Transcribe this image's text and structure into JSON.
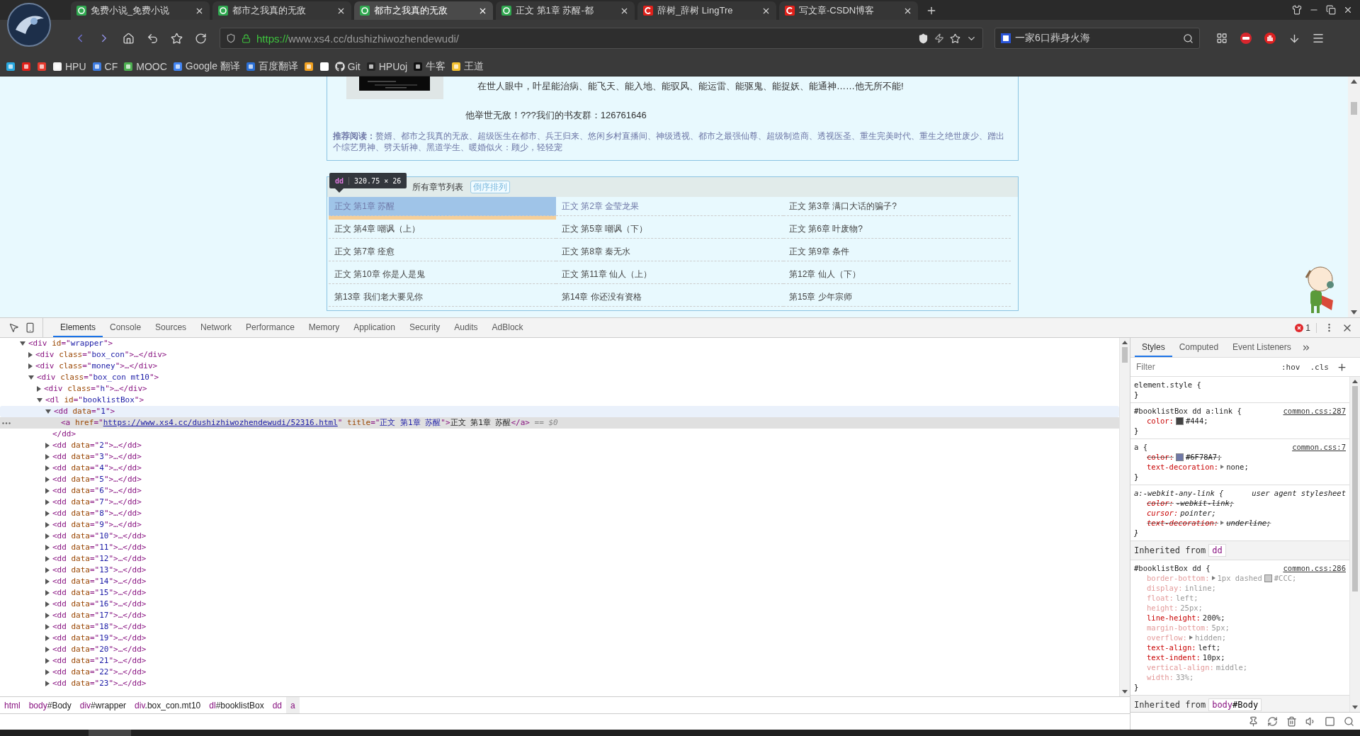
{
  "browser": {
    "tabs": [
      {
        "title": "免费小说_免费小说",
        "kind": "book",
        "selected": false
      },
      {
        "title": "都市之我真的无敌",
        "kind": "book",
        "selected": false
      },
      {
        "title": "都市之我真的无敌",
        "kind": "book",
        "selected": true
      },
      {
        "title": "正文 第1章 苏醒-都",
        "kind": "book",
        "selected": false
      },
      {
        "title": "辞树_辞树 LingTre",
        "kind": "csdn",
        "selected": false
      },
      {
        "title": "写文章-CSDN博客",
        "kind": "csdn",
        "selected": false
      }
    ],
    "address": {
      "scheme": "https://",
      "rest": "www.xs4.cc/dushizhiwozhendewudi/"
    },
    "search": {
      "value": "一家6口葬身火海"
    },
    "bookmarks": [
      {
        "kind": "icon"
      },
      {
        "kind": "icon"
      },
      {
        "kind": "icon"
      },
      {
        "kind": "link",
        "label": "HPU"
      },
      {
        "kind": "link",
        "label": "CF"
      },
      {
        "kind": "link",
        "label": "MOOC"
      },
      {
        "kind": "link",
        "label": "Google 翻译"
      },
      {
        "kind": "link",
        "label": "百度翻译"
      },
      {
        "kind": "icon"
      },
      {
        "kind": "icon"
      },
      {
        "kind": "link",
        "label": "Git"
      },
      {
        "kind": "link",
        "label": "HPUoj"
      },
      {
        "kind": "link",
        "label": "牛客"
      },
      {
        "kind": "link",
        "label": "王道"
      }
    ]
  },
  "page": {
    "intro": "在世人眼中，叶星能治病、能飞天、能入地、能驭风、能运雷、能驱鬼、能捉妖、能通神……他无所不能!",
    "group_line": "他举世无敌！???我们的书友群：126761646",
    "recommend": "**推荐阅读：**赘婿、都市之我真的无敌、超级医生在都市、兵王归来、悠闲乡村直播间、神级透视、都市之最强仙尊、超级制造商、透视医圣、重生完美时代、重生之绝世废少、蹭出个综艺男神、劈天斩神、黑道学生、暖婚似火：顾少，轻轻宠",
    "chapter_list": {
      "heading": "所有章节列表",
      "sort_button": "倒序排列",
      "chapters": [
        {
          "title": "正文 第1章 苏醒",
          "selected": true,
          "visited": true
        },
        {
          "title": "正文 第2章 金莹龙果",
          "selected": false,
          "visited": true
        },
        {
          "title": "正文 第3章 满口大话的骗子?",
          "selected": false,
          "visited": false
        },
        {
          "title": "正文 第4章 嘲讽（上）",
          "selected": false,
          "visited": false
        },
        {
          "title": "正文 第5章 嘲讽（下）",
          "selected": false,
          "visited": false
        },
        {
          "title": "正文 第6章 叶废物?",
          "selected": false,
          "visited": false
        },
        {
          "title": "正文 第7章 痊愈",
          "selected": false,
          "visited": false
        },
        {
          "title": "正文 第8章 秦无水",
          "selected": false,
          "visited": false
        },
        {
          "title": "正文 第9章 条件",
          "selected": false,
          "visited": false
        },
        {
          "title": "正文 第10章 你是人是鬼",
          "selected": false,
          "visited": false
        },
        {
          "title": "正文 第11章 仙人（上）",
          "selected": false,
          "visited": false
        },
        {
          "title": "第12章 仙人（下）",
          "selected": false,
          "visited": false
        },
        {
          "title": "第13章 我们老大要见你",
          "selected": false,
          "visited": false
        },
        {
          "title": "第14章 你还没有资格",
          "selected": false,
          "visited": false
        },
        {
          "title": "第15章 少年宗师",
          "selected": false,
          "visited": false
        }
      ]
    },
    "inspect_tooltip": {
      "tag": "dd",
      "size": "320.75 × 26"
    }
  },
  "devtools": {
    "tabs": [
      {
        "label": "Elements",
        "selected": true
      },
      {
        "label": "Console",
        "selected": false
      },
      {
        "label": "Sources",
        "selected": false
      },
      {
        "label": "Network",
        "selected": false
      },
      {
        "label": "Performance",
        "selected": false
      },
      {
        "label": "Memory",
        "selected": false
      },
      {
        "label": "Application",
        "selected": false
      },
      {
        "label": "Security",
        "selected": false
      },
      {
        "label": "Audits",
        "selected": false
      },
      {
        "label": "AdBlock",
        "selected": false
      }
    ],
    "error_count": "1",
    "dom_tree": [
      {
        "segments": [
          {
            "kind": "tag",
            "text": "<div "
          },
          {
            "kind": "attr",
            "text": "id"
          },
          {
            "kind": "tag",
            "text": "=\""
          },
          {
            "kind": "value",
            "text": "wrapper"
          },
          {
            "kind": "tag",
            "text": "\">"
          }
        ],
        "expanded": true,
        "selected": false,
        "hovered": false,
        "children": [
          {
            "segments": [
              {
                "kind": "tag",
                "text": "<div "
              },
              {
                "kind": "attr",
                "text": "class"
              },
              {
                "kind": "tag",
                "text": "=\""
              },
              {
                "kind": "value",
                "text": "box_con"
              },
              {
                "kind": "tag",
                "text": "\">…</div>"
              }
            ],
            "expanded": false,
            "selected": false,
            "hovered": false
          },
          {
            "segments": [
              {
                "kind": "tag",
                "text": "<div "
              },
              {
                "kind": "attr",
                "text": "class"
              },
              {
                "kind": "tag",
                "text": "=\""
              },
              {
                "kind": "value",
                "text": "money"
              },
              {
                "kind": "tag",
                "text": "\">…</div>"
              }
            ],
            "expanded": false,
            "selected": false,
            "hovered": false
          },
          {
            "segments": [
              {
                "kind": "tag",
                "text": "<div "
              },
              {
                "kind": "attr",
                "text": "class"
              },
              {
                "kind": "tag",
                "text": "=\""
              },
              {
                "kind": "value",
                "text": "box_con mt10"
              },
              {
                "kind": "tag",
                "text": "\">"
              }
            ],
            "expanded": true,
            "selected": false,
            "hovered": false,
            "children": [
              {
                "segments": [
                  {
                    "kind": "tag",
                    "text": "<div "
                  },
                  {
                    "kind": "attr",
                    "text": "class"
                  },
                  {
                    "kind": "tag",
                    "text": "=\""
                  },
                  {
                    "kind": "value",
                    "text": "h"
                  },
                  {
                    "kind": "tag",
                    "text": "\">…</div>"
                  }
                ],
                "expanded": false,
                "selected": false,
                "hovered": false
              },
              {
                "segments": [
                  {
                    "kind": "tag",
                    "text": "<dl "
                  },
                  {
                    "kind": "attr",
                    "text": "id"
                  },
                  {
                    "kind": "tag",
                    "text": "=\""
                  },
                  {
                    "kind": "value",
                    "text": "booklistBox"
                  },
                  {
                    "kind": "tag",
                    "text": "\">"
                  }
                ],
                "expanded": true,
                "selected": false,
                "hovered": false,
                "children": [
                  {
                    "segments": [
                      {
                        "kind": "tag",
                        "text": "<dd "
                      },
                      {
                        "kind": "attr",
                        "text": "data"
                      },
                      {
                        "kind": "tag",
                        "text": "=\""
                      },
                      {
                        "kind": "value",
                        "text": "1"
                      },
                      {
                        "kind": "tag",
                        "text": "\">"
                      }
                    ],
                    "expanded": true,
                    "selected": false,
                    "hovered": true,
                    "closing": [
                      {
                        "kind": "tag",
                        "text": "</dd>"
                      }
                    ],
                    "children": [
                      {
                        "segments": [
                          {
                            "kind": "tag",
                            "text": "<a "
                          },
                          {
                            "kind": "attr",
                            "text": "href"
                          },
                          {
                            "kind": "tag",
                            "text": "=\""
                          },
                          {
                            "kind": "link",
                            "text": "https://www.xs4.cc/dushizhiwozhendewudi/52316.html"
                          },
                          {
                            "kind": "tag",
                            "text": "\" "
                          },
                          {
                            "kind": "attr",
                            "text": "title"
                          },
                          {
                            "kind": "tag",
                            "text": "=\""
                          },
                          {
                            "kind": "value",
                            "text": "正文 第1章 苏醒"
                          },
                          {
                            "kind": "tag",
                            "text": "\">"
                          },
                          {
                            "kind": "text",
                            "text": "正文 第1章 苏醒"
                          },
                          {
                            "kind": "tag",
                            "text": "</a>"
                          },
                          {
                            "kind": "dim",
                            "text": " == $0"
                          }
                        ],
                        "selected": true,
                        "hovered": false
                      }
                    ]
                  },
                  {
                    "segments": [
                      {
                        "kind": "tag",
                        "text": "<dd "
                      },
                      {
                        "kind": "attr",
                        "text": "data"
                      },
                      {
                        "kind": "tag",
                        "text": "=\""
                      },
                      {
                        "kind": "value",
                        "text": "2"
                      },
                      {
                        "kind": "tag",
                        "text": "\">…</dd>"
                      }
                    ],
                    "expanded": false,
                    "selected": false,
                    "hovered": false
                  },
                  {
                    "segments": [
                      {
                        "kind": "tag",
                        "text": "<dd "
                      },
                      {
                        "kind": "attr",
                        "text": "data"
                      },
                      {
                        "kind": "tag",
                        "text": "=\""
                      },
                      {
                        "kind": "value",
                        "text": "3"
                      },
                      {
                        "kind": "tag",
                        "text": "\">…</dd>"
                      }
                    ],
                    "expanded": false,
                    "selected": false,
                    "hovered": false
                  },
                  {
                    "segments": [
                      {
                        "kind": "tag",
                        "text": "<dd "
                      },
                      {
                        "kind": "attr",
                        "text": "data"
                      },
                      {
                        "kind": "tag",
                        "text": "=\""
                      },
                      {
                        "kind": "value",
                        "text": "4"
                      },
                      {
                        "kind": "tag",
                        "text": "\">…</dd>"
                      }
                    ],
                    "expanded": false,
                    "selected": false,
                    "hovered": false
                  },
                  {
                    "segments": [
                      {
                        "kind": "tag",
                        "text": "<dd "
                      },
                      {
                        "kind": "attr",
                        "text": "data"
                      },
                      {
                        "kind": "tag",
                        "text": "=\""
                      },
                      {
                        "kind": "value",
                        "text": "5"
                      },
                      {
                        "kind": "tag",
                        "text": "\">…</dd>"
                      }
                    ],
                    "expanded": false,
                    "selected": false,
                    "hovered": false
                  },
                  {
                    "segments": [
                      {
                        "kind": "tag",
                        "text": "<dd "
                      },
                      {
                        "kind": "attr",
                        "text": "data"
                      },
                      {
                        "kind": "tag",
                        "text": "=\""
                      },
                      {
                        "kind": "value",
                        "text": "6"
                      },
                      {
                        "kind": "tag",
                        "text": "\">…</dd>"
                      }
                    ],
                    "expanded": false,
                    "selected": false,
                    "hovered": false
                  },
                  {
                    "segments": [
                      {
                        "kind": "tag",
                        "text": "<dd "
                      },
                      {
                        "kind": "attr",
                        "text": "data"
                      },
                      {
                        "kind": "tag",
                        "text": "=\""
                      },
                      {
                        "kind": "value",
                        "text": "7"
                      },
                      {
                        "kind": "tag",
                        "text": "\">…</dd>"
                      }
                    ],
                    "expanded": false,
                    "selected": false,
                    "hovered": false
                  },
                  {
                    "segments": [
                      {
                        "kind": "tag",
                        "text": "<dd "
                      },
                      {
                        "kind": "attr",
                        "text": "data"
                      },
                      {
                        "kind": "tag",
                        "text": "=\""
                      },
                      {
                        "kind": "value",
                        "text": "8"
                      },
                      {
                        "kind": "tag",
                        "text": "\">…</dd>"
                      }
                    ],
                    "expanded": false,
                    "selected": false,
                    "hovered": false
                  },
                  {
                    "segments": [
                      {
                        "kind": "tag",
                        "text": "<dd "
                      },
                      {
                        "kind": "attr",
                        "text": "data"
                      },
                      {
                        "kind": "tag",
                        "text": "=\""
                      },
                      {
                        "kind": "value",
                        "text": "9"
                      },
                      {
                        "kind": "tag",
                        "text": "\">…</dd>"
                      }
                    ],
                    "expanded": false,
                    "selected": false,
                    "hovered": false
                  },
                  {
                    "segments": [
                      {
                        "kind": "tag",
                        "text": "<dd "
                      },
                      {
                        "kind": "attr",
                        "text": "data"
                      },
                      {
                        "kind": "tag",
                        "text": "=\""
                      },
                      {
                        "kind": "value",
                        "text": "10"
                      },
                      {
                        "kind": "tag",
                        "text": "\">…</dd>"
                      }
                    ],
                    "expanded": false,
                    "selected": false,
                    "hovered": false
                  },
                  {
                    "segments": [
                      {
                        "kind": "tag",
                        "text": "<dd "
                      },
                      {
                        "kind": "attr",
                        "text": "data"
                      },
                      {
                        "kind": "tag",
                        "text": "=\""
                      },
                      {
                        "kind": "value",
                        "text": "11"
                      },
                      {
                        "kind": "tag",
                        "text": "\">…</dd>"
                      }
                    ],
                    "expanded": false,
                    "selected": false,
                    "hovered": false
                  },
                  {
                    "segments": [
                      {
                        "kind": "tag",
                        "text": "<dd "
                      },
                      {
                        "kind": "attr",
                        "text": "data"
                      },
                      {
                        "kind": "tag",
                        "text": "=\""
                      },
                      {
                        "kind": "value",
                        "text": "12"
                      },
                      {
                        "kind": "tag",
                        "text": "\">…</dd>"
                      }
                    ],
                    "expanded": false,
                    "selected": false,
                    "hovered": false
                  },
                  {
                    "segments": [
                      {
                        "kind": "tag",
                        "text": "<dd "
                      },
                      {
                        "kind": "attr",
                        "text": "data"
                      },
                      {
                        "kind": "tag",
                        "text": "=\""
                      },
                      {
                        "kind": "value",
                        "text": "13"
                      },
                      {
                        "kind": "tag",
                        "text": "\">…</dd>"
                      }
                    ],
                    "expanded": false,
                    "selected": false,
                    "hovered": false
                  },
                  {
                    "segments": [
                      {
                        "kind": "tag",
                        "text": "<dd "
                      },
                      {
                        "kind": "attr",
                        "text": "data"
                      },
                      {
                        "kind": "tag",
                        "text": "=\""
                      },
                      {
                        "kind": "value",
                        "text": "14"
                      },
                      {
                        "kind": "tag",
                        "text": "\">…</dd>"
                      }
                    ],
                    "expanded": false,
                    "selected": false,
                    "hovered": false
                  },
                  {
                    "segments": [
                      {
                        "kind": "tag",
                        "text": "<dd "
                      },
                      {
                        "kind": "attr",
                        "text": "data"
                      },
                      {
                        "kind": "tag",
                        "text": "=\""
                      },
                      {
                        "kind": "value",
                        "text": "15"
                      },
                      {
                        "kind": "tag",
                        "text": "\">…</dd>"
                      }
                    ],
                    "expanded": false,
                    "selected": false,
                    "hovered": false
                  },
                  {
                    "segments": [
                      {
                        "kind": "tag",
                        "text": "<dd "
                      },
                      {
                        "kind": "attr",
                        "text": "data"
                      },
                      {
                        "kind": "tag",
                        "text": "=\""
                      },
                      {
                        "kind": "value",
                        "text": "16"
                      },
                      {
                        "kind": "tag",
                        "text": "\">…</dd>"
                      }
                    ],
                    "expanded": false,
                    "selected": false,
                    "hovered": false
                  },
                  {
                    "segments": [
                      {
                        "kind": "tag",
                        "text": "<dd "
                      },
                      {
                        "kind": "attr",
                        "text": "data"
                      },
                      {
                        "kind": "tag",
                        "text": "=\""
                      },
                      {
                        "kind": "value",
                        "text": "17"
                      },
                      {
                        "kind": "tag",
                        "text": "\">…</dd>"
                      }
                    ],
                    "expanded": false,
                    "selected": false,
                    "hovered": false
                  },
                  {
                    "segments": [
                      {
                        "kind": "tag",
                        "text": "<dd "
                      },
                      {
                        "kind": "attr",
                        "text": "data"
                      },
                      {
                        "kind": "tag",
                        "text": "=\""
                      },
                      {
                        "kind": "value",
                        "text": "18"
                      },
                      {
                        "kind": "tag",
                        "text": "\">…</dd>"
                      }
                    ],
                    "expanded": false,
                    "selected": false,
                    "hovered": false
                  },
                  {
                    "segments": [
                      {
                        "kind": "tag",
                        "text": "<dd "
                      },
                      {
                        "kind": "attr",
                        "text": "data"
                      },
                      {
                        "kind": "tag",
                        "text": "=\""
                      },
                      {
                        "kind": "value",
                        "text": "19"
                      },
                      {
                        "kind": "tag",
                        "text": "\">…</dd>"
                      }
                    ],
                    "expanded": false,
                    "selected": false,
                    "hovered": false
                  },
                  {
                    "segments": [
                      {
                        "kind": "tag",
                        "text": "<dd "
                      },
                      {
                        "kind": "attr",
                        "text": "data"
                      },
                      {
                        "kind": "tag",
                        "text": "=\""
                      },
                      {
                        "kind": "value",
                        "text": "20"
                      },
                      {
                        "kind": "tag",
                        "text": "\">…</dd>"
                      }
                    ],
                    "expanded": false,
                    "selected": false,
                    "hovered": false
                  },
                  {
                    "segments": [
                      {
                        "kind": "tag",
                        "text": "<dd "
                      },
                      {
                        "kind": "attr",
                        "text": "data"
                      },
                      {
                        "kind": "tag",
                        "text": "=\""
                      },
                      {
                        "kind": "value",
                        "text": "21"
                      },
                      {
                        "kind": "tag",
                        "text": "\">…</dd>"
                      }
                    ],
                    "expanded": false,
                    "selected": false,
                    "hovered": false
                  },
                  {
                    "segments": [
                      {
                        "kind": "tag",
                        "text": "<dd "
                      },
                      {
                        "kind": "attr",
                        "text": "data"
                      },
                      {
                        "kind": "tag",
                        "text": "=\""
                      },
                      {
                        "kind": "value",
                        "text": "22"
                      },
                      {
                        "kind": "tag",
                        "text": "\">…</dd>"
                      }
                    ],
                    "expanded": false,
                    "selected": false,
                    "hovered": false
                  },
                  {
                    "segments": [
                      {
                        "kind": "tag",
                        "text": "<dd "
                      },
                      {
                        "kind": "attr",
                        "text": "data"
                      },
                      {
                        "kind": "tag",
                        "text": "=\""
                      },
                      {
                        "kind": "value",
                        "text": "23"
                      },
                      {
                        "kind": "tag",
                        "text": "\">…</dd>"
                      }
                    ],
                    "expanded": false,
                    "selected": false,
                    "hovered": false
                  }
                ]
              }
            ]
          }
        ]
      }
    ],
    "breadcrumbs": [
      {
        "tag": "html",
        "selected": false
      },
      {
        "tag": "body",
        "rest": "#Body",
        "selected": false
      },
      {
        "tag": "div",
        "rest": "#wrapper",
        "selected": false
      },
      {
        "tag": "div",
        "rest": ".box_con.mt10",
        "selected": false
      },
      {
        "tag": "dl",
        "rest": "#booklistBox",
        "selected": false
      },
      {
        "tag": "dd",
        "selected": false
      },
      {
        "tag": "a",
        "selected": true
      }
    ],
    "styles": {
      "tabs": [
        {
          "label": "Styles",
          "selected": true
        },
        {
          "label": "Computed",
          "selected": false
        },
        {
          "label": "Event Listeners",
          "selected": false
        }
      ],
      "filter_placeholder": "Filter",
      "hov": ":hov",
      "cls": ".cls",
      "rules": [
        {
          "kind": "rule",
          "selector": "element.style {",
          "close": "}",
          "user_agent": false
        },
        {
          "kind": "rule",
          "selector": "#booklistBox dd a:link {",
          "source": "common.css:287",
          "close": "}",
          "user_agent": false,
          "props": [
            {
              "name": "color:",
              "color": "#444444",
              "value": "#444;",
              "struck": false,
              "inactive": false,
              "expandable": false
            }
          ]
        },
        {
          "kind": "rule",
          "selector": "a {",
          "source": "common.css:7",
          "close": "}",
          "user_agent": false,
          "props": [
            {
              "name": "color:",
              "color": "#6f78a7",
              "value": "#6F78A7;",
              "struck": true,
              "inactive": false,
              "expandable": false
            },
            {
              "name": "text-decoration:",
              "value": "none;",
              "struck": false,
              "inactive": false,
              "expandable": true
            }
          ]
        },
        {
          "kind": "rule",
          "selector": "a:-webkit-any-link {",
          "source": "user agent stylesheet",
          "close": "}",
          "user_agent": true,
          "props": [
            {
              "name": "color:",
              "value": "-webkit-link;",
              "struck": true,
              "inactive": false,
              "expandable": false
            },
            {
              "name": "cursor:",
              "value": "pointer;",
              "struck": false,
              "inactive": false,
              "expandable": false
            },
            {
              "name": "text-decoration:",
              "value": "underline;",
              "struck": true,
              "inactive": false,
              "expandable": true
            }
          ]
        },
        {
          "kind": "inherited",
          "label": "Inherited from",
          "tag": "dd"
        },
        {
          "kind": "rule",
          "selector": "#booklistBox dd {",
          "source": "common.css:286",
          "close": "}",
          "user_agent": false,
          "props": [
            {
              "name": "border-bottom:",
              "pre": "1px dashed",
              "color": "#cccccc",
              "value": "#CCC;",
              "struck": false,
              "inactive": true,
              "expandable": true
            },
            {
              "name": "display:",
              "value": "inline;",
              "struck": false,
              "inactive": true,
              "expandable": false
            },
            {
              "name": "float:",
              "value": "left;",
              "struck": false,
              "inactive": true,
              "expandable": false
            },
            {
              "name": "height:",
              "value": "25px;",
              "struck": false,
              "inactive": true,
              "expandable": false
            },
            {
              "name": "line-height:",
              "value": "200%;",
              "struck": false,
              "inactive": false,
              "expandable": false
            },
            {
              "name": "margin-bottom:",
              "value": "5px;",
              "struck": false,
              "inactive": true,
              "expandable": false
            },
            {
              "name": "overflow:",
              "value": "hidden;",
              "struck": false,
              "inactive": true,
              "expandable": true
            },
            {
              "name": "text-align:",
              "value": "left;",
              "struck": false,
              "inactive": false,
              "expandable": false
            },
            {
              "name": "text-indent:",
              "value": "10px;",
              "struck": false,
              "inactive": false,
              "expandable": false
            },
            {
              "name": "vertical-align:",
              "value": "middle;",
              "struck": false,
              "inactive": true,
              "expandable": false
            },
            {
              "name": "width:",
              "value": "33%;",
              "struck": false,
              "inactive": true,
              "expandable": false
            }
          ]
        },
        {
          "kind": "inherited",
          "label": "Inherited from",
          "tag": "body",
          "rest": "#Body"
        }
      ]
    }
  }
}
